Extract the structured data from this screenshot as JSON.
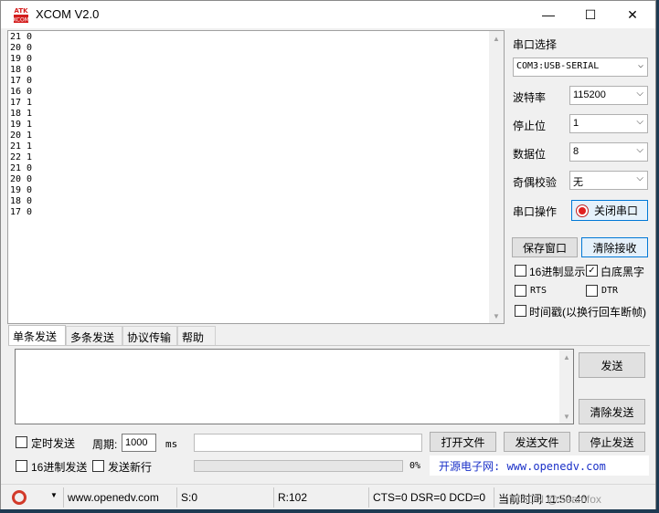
{
  "window": {
    "title": "XCOM V2.0",
    "minimize": "—",
    "maximize": "☐",
    "close": "✕",
    "icon_text": "ATK",
    "icon_color": "#d41c1c"
  },
  "receive": {
    "lines": "21 0\n20 0\n19 0\n18 0\n17 0\n16 0\n17 1\n18 1\n19 1\n20 1\n21 1\n22 1\n21 0\n20 0\n19 0\n18 0\n17 0"
  },
  "panel": {
    "port_select_label": "串口选择",
    "port_value": "COM3:USB-SERIAL",
    "baud_label": "波特率",
    "baud_value": "115200",
    "stopbits_label": "停止位",
    "stopbits_value": "1",
    "databits_label": "数据位",
    "databits_value": "8",
    "parity_label": "奇偶校验",
    "parity_value": "无",
    "port_op_label": "串口操作",
    "close_port_button": "关闭串口",
    "led_color": "#e02020",
    "save_window_button": "保存窗口",
    "clear_receive_button": "清除接收",
    "hex_display_label": "16进制显示",
    "hex_display_checked": false,
    "white_bg_label": "白底黑字",
    "white_bg_checked": true,
    "rts_label": "RTS",
    "rts_checked": false,
    "dtr_label": "DTR",
    "dtr_checked": false,
    "timestamp_label": "时间戳(以换行回车断帧)",
    "timestamp_checked": false
  },
  "tabs": [
    "单条发送",
    "多条发送",
    "协议传输",
    "帮助"
  ],
  "send": {
    "send_button": "发送",
    "clear_send_button": "清除发送",
    "timed_send_label": "定时发送",
    "timed_send_checked": false,
    "period_label": "周期:",
    "period_value": "1000",
    "period_unit": "ms",
    "open_file_button": "打开文件",
    "send_file_button": "发送文件",
    "stop_send_button": "停止发送",
    "hex_send_label": "16进制发送",
    "hex_send_checked": false,
    "send_newline_label": "发送新行",
    "send_newline_checked": false,
    "progress_text": "0%",
    "progress_fraction": 0,
    "site_link": "开源电子网: www.openedv.com"
  },
  "status": {
    "website": "www.openedv.com",
    "sent": "S:0",
    "received": "R:102",
    "lines": "CTS=0 DSR=0 DCD=0",
    "time": "当前时间 11:50:40",
    "watermark": "CSDN @Seamfox"
  }
}
